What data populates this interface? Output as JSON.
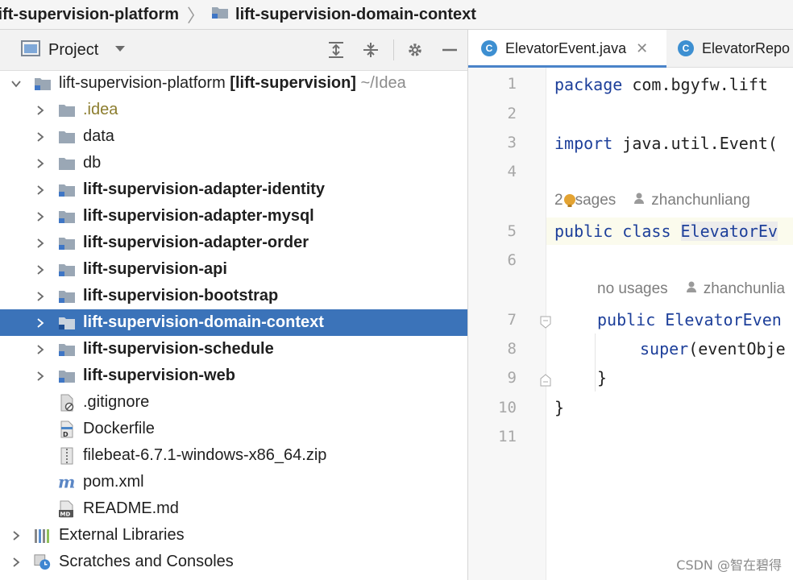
{
  "breadcrumb": {
    "project": "lift-supervision-platform",
    "module": "lift-supervision-domain-context"
  },
  "project_panel": {
    "title": "Project",
    "tree": [
      {
        "label": "lift-supervision-platform",
        "extra": "[lift-supervision]",
        "path": "~/Idea",
        "level": 0,
        "expanded": true,
        "icon": "module-folder-icon"
      },
      {
        "label": ".idea",
        "level": 1,
        "icon": "folder-icon",
        "style": "idea"
      },
      {
        "label": "data",
        "level": 1,
        "icon": "folder-icon"
      },
      {
        "label": "db",
        "level": 1,
        "icon": "folder-icon"
      },
      {
        "label": "lift-supervision-adapter-identity",
        "level": 1,
        "icon": "module-folder-icon",
        "bold": true
      },
      {
        "label": "lift-supervision-adapter-mysql",
        "level": 1,
        "icon": "module-folder-icon",
        "bold": true
      },
      {
        "label": "lift-supervision-adapter-order",
        "level": 1,
        "icon": "module-folder-icon",
        "bold": true
      },
      {
        "label": "lift-supervision-api",
        "level": 1,
        "icon": "module-folder-icon",
        "bold": true
      },
      {
        "label": "lift-supervision-bootstrap",
        "level": 1,
        "icon": "module-folder-icon",
        "bold": true
      },
      {
        "label": "lift-supervision-domain-context",
        "level": 1,
        "icon": "module-folder-icon",
        "bold": true,
        "selected": true
      },
      {
        "label": "lift-supervision-schedule",
        "level": 1,
        "icon": "module-folder-icon",
        "bold": true
      },
      {
        "label": "lift-supervision-web",
        "level": 1,
        "icon": "module-folder-icon",
        "bold": true
      },
      {
        "label": ".gitignore",
        "level": 1,
        "icon": "gitignore-file-icon",
        "leaf": true
      },
      {
        "label": "Dockerfile",
        "level": 1,
        "icon": "dockerfile-icon",
        "leaf": true
      },
      {
        "label": "filebeat-6.7.1-windows-x86_64.zip",
        "level": 1,
        "icon": "zip-file-icon",
        "leaf": true
      },
      {
        "label": "pom.xml",
        "level": 1,
        "icon": "maven-file-icon",
        "leaf": true
      },
      {
        "label": "README.md",
        "level": 1,
        "icon": "markdown-file-icon",
        "leaf": true
      },
      {
        "label": "External Libraries",
        "level": 0,
        "icon": "libraries-icon"
      },
      {
        "label": "Scratches and Consoles",
        "level": 0,
        "icon": "scratches-icon"
      }
    ]
  },
  "editor": {
    "tabs": [
      {
        "label": "ElevatorEvent.java",
        "active": true
      },
      {
        "label": "ElevatorRepo",
        "active": false
      }
    ],
    "line_numbers": [
      "1",
      "2",
      "3",
      "4",
      "5",
      "6",
      "7",
      "8",
      "9",
      "10",
      "11"
    ],
    "code": {
      "line1_kw": "package",
      "line1_rest": " com.bgyfw.lift",
      "line3_kw": "import",
      "line3_rest": " java.util.Event(",
      "line5_kw1": "public",
      "line5_kw2": " class ",
      "line5_class": "ElevatorEv",
      "line7_kw": "public",
      "line7_class": " ElevatorEven",
      "line8_kw": "super",
      "line8_rest": "(eventObje",
      "line9": "}",
      "line10": "}"
    },
    "inlays": {
      "usages_prefix": "2",
      "usages_suffix": "sages",
      "author1": "zhanchunliang",
      "no_usages": "no usages",
      "author2": "zhanchunlia"
    }
  },
  "watermark": "CSDN @智在碧得",
  "colors": {
    "selection": "#3b73b9",
    "keyword": "#1d3f9a",
    "tab_underline": "#4a83c9"
  }
}
